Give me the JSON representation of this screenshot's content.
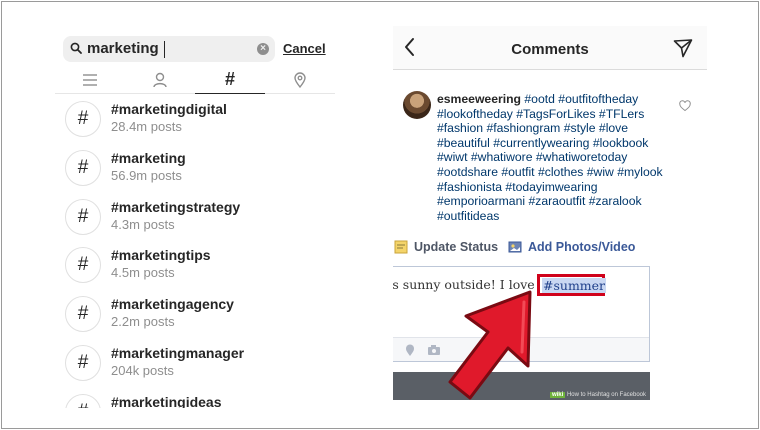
{
  "search": {
    "query": "marketing",
    "cancel_label": "Cancel",
    "tabs": [
      {
        "icon": "list-icon"
      },
      {
        "icon": "person-icon"
      },
      {
        "icon": "hashtag-icon",
        "label": "#",
        "active": true
      },
      {
        "icon": "location-pin-icon"
      }
    ],
    "results": [
      {
        "tag": "#marketingdigital",
        "count": "28.4m posts"
      },
      {
        "tag": "#marketing",
        "count": "56.9m posts"
      },
      {
        "tag": "#marketingstrategy",
        "count": "4.3m posts"
      },
      {
        "tag": "#marketingtips",
        "count": "4.5m posts"
      },
      {
        "tag": "#marketingagency",
        "count": "2.2m posts"
      },
      {
        "tag": "#marketingmanager",
        "count": "204k posts"
      },
      {
        "tag": "#marketingideas",
        "count": ""
      }
    ],
    "result_icon_glyph": "#"
  },
  "comments": {
    "title": "Comments",
    "username": "esmeeweering",
    "hashtags": "#ootd #outfitoftheday #lookoftheday #TagsForLikes #TFLers #fashion #fashiongram #style #love #beautiful #currentlywearing #lookbook #wiwt #whatiwore #whatiworetoday #ootdshare #outfit #clothes #wiw #mylook #fashionista #todayimwearing #emporioarmani #zaraoutfit #zaralook #outfitideas"
  },
  "facebook": {
    "update_status_label": "Update Status",
    "add_photos_label": "Add Photos/Video",
    "status_text": "It's sunny outside! I love it",
    "highlighted_hashtag": "#summer",
    "highlight_color": "#d0021b",
    "watermark_brand": "wiki",
    "watermark_text": "How to Hashtag on Facebook"
  },
  "colors": {
    "arrow": "#e0192b",
    "link": "#00376b",
    "fb_blue": "#3b5998"
  }
}
